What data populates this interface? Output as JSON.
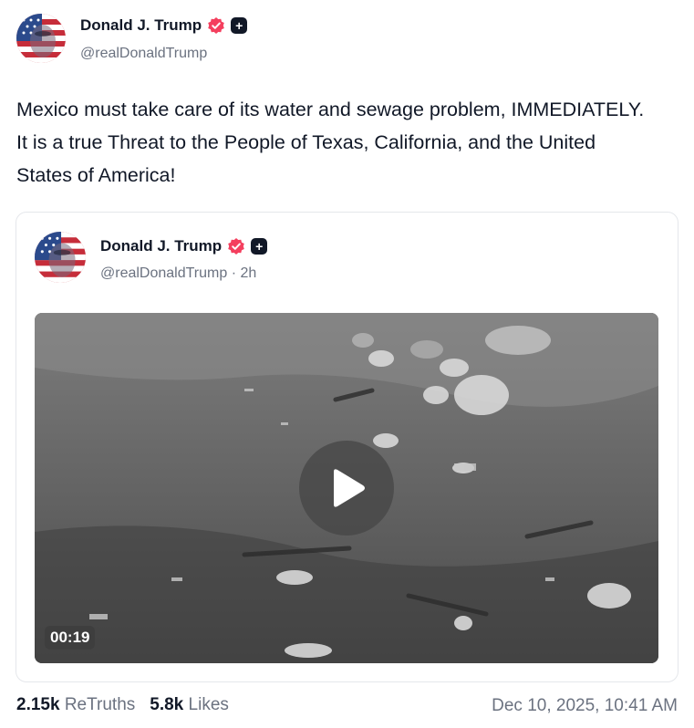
{
  "post": {
    "author_name": "Donald J. Trump",
    "author_handle": "@realDonaldTrump",
    "text": "Mexico must take care of its water and sewage problem, IMMEDIATELY. It is a true Threat to the People of Texas, California, and the United States of America!"
  },
  "quoted_post": {
    "author_name": "Donald J. Trump",
    "author_handle": "@realDonaldTrump · 2h",
    "video_duration": "00:19"
  },
  "stats": {
    "retruths_count": "2.15k",
    "retruths_label": "ReTruths",
    "likes_count": "5.8k",
    "likes_label": "Likes"
  },
  "timestamp": "Dec 10, 2025, 10:41 AM",
  "colors": {
    "verified_badge": "#f43f5e",
    "plus_badge": "#111827",
    "muted_text": "#6b7280",
    "card_border": "#e5e7eb"
  },
  "icons": {
    "verified": "verified-check-icon",
    "plus": "plus-badge-icon",
    "play": "play-icon"
  }
}
